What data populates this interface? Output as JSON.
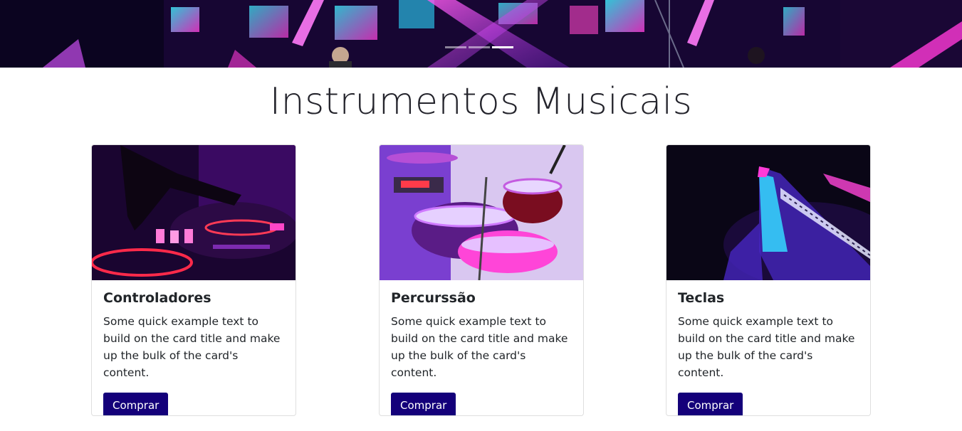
{
  "hero": {
    "indicators": [
      {
        "active": false
      },
      {
        "active": false
      },
      {
        "active": true
      }
    ]
  },
  "page": {
    "title": "Instrumentos Musicais"
  },
  "cards": [
    {
      "title": "Controladores",
      "text": "Some quick example text to build on the card title and make up the bulk of the card's content.",
      "button": "Comprar",
      "image": "dj-controller-photo"
    },
    {
      "title": "Percurssão",
      "text": "Some quick example text to build on the card title and make up the bulk of the card's content.",
      "button": "Comprar",
      "image": "drum-kit-photo"
    },
    {
      "title": "Teclas",
      "text": "Some quick example text to build on the card title and make up the bulk of the card's content.",
      "button": "Comprar",
      "image": "keyboard-photo"
    }
  ],
  "colors": {
    "button_bg": "#14007a",
    "hero_bg": "#2a0b52",
    "neon_pink": "#ff2fd6",
    "neon_purple": "#8a2be2"
  }
}
